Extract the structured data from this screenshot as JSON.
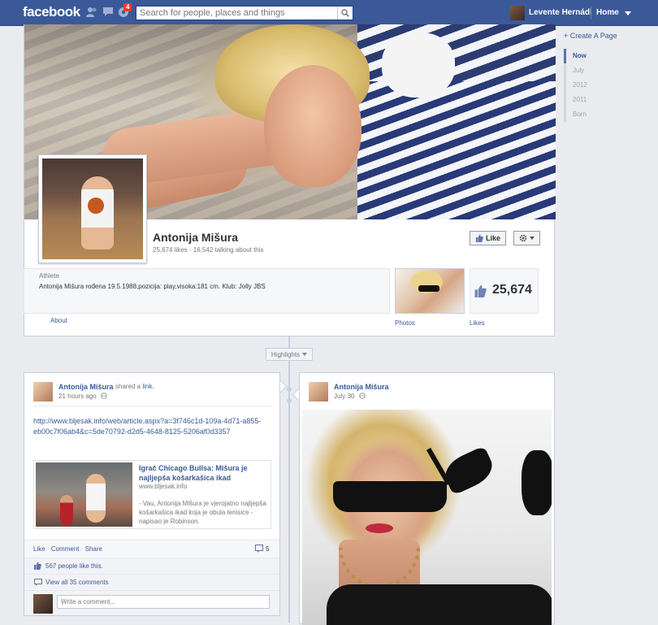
{
  "topbar": {
    "logo": "facebook",
    "notifications_count": "4",
    "search_placeholder": "Search for people, places and things",
    "user_name": "Levente Hernádi",
    "home": "Home"
  },
  "sidebar": {
    "create_page": "+ Create A Page",
    "timeline": [
      "Now",
      "July",
      "2012",
      "2011",
      "Born"
    ]
  },
  "page": {
    "name": "Antonija Mišura",
    "stats": "25,674 likes · 16,542 talking about this",
    "like_button": "Like",
    "category": "Athlete",
    "description": "Antonija Mišura rođena 19.5.1988,pozicija: play,visoka:181 cm. Klub: Jolly JBS",
    "about_label": "About",
    "photos_label": "Photos",
    "likes_count": "25,674",
    "likes_label": "Likes"
  },
  "timeline": {
    "highlights": "Highlights"
  },
  "post1": {
    "author": "Antonija Mišura",
    "action": "shared a",
    "action_link": "link.",
    "time": "21 hours ago",
    "url": "http://www.bljesak.info/web/article.aspx?a=3f746c1d-109a-4d71-a855-eb00c7f06ab4&c=5de70792-d2d5-4648-8125-5206af0d3357",
    "preview_title": "Igrač Chicago Bullsa: Mišura je najljepša košarkašica ikad",
    "preview_domain": "www.bljesak.info",
    "preview_desc": "- Vau, Antonija Mišura je vjerojatno najljepša košarkašica ikad koja je obula tenisice - napisao je Robinson.",
    "like": "Like",
    "comment": "Comment",
    "share": "Share",
    "comment_count": "5",
    "likes_text": "567 people like this.",
    "view_comments": "View all 35 comments",
    "write_placeholder": "Write a comment..."
  },
  "post2": {
    "author": "Antonija Mišura",
    "time": "July 30"
  }
}
